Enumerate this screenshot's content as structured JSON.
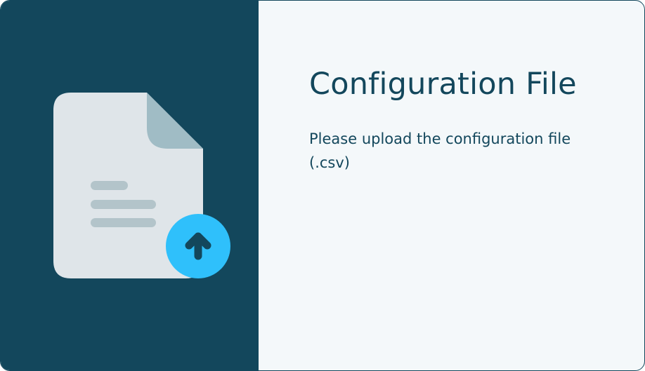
{
  "dialog": {
    "title": "Configuration File",
    "description": "Please upload the configuration file (.csv)"
  },
  "illustration": {
    "icon": "file-upload-icon",
    "badge_icon": "upload-arrow-icon"
  },
  "colors": {
    "panel_dark": "#13475c",
    "panel_light": "#f4f8fa",
    "document_body": "#dfe5e9",
    "document_fold": "#a0bcc5",
    "document_lines": "#b3c4ca",
    "upload_badge": "#2fc0fb"
  }
}
